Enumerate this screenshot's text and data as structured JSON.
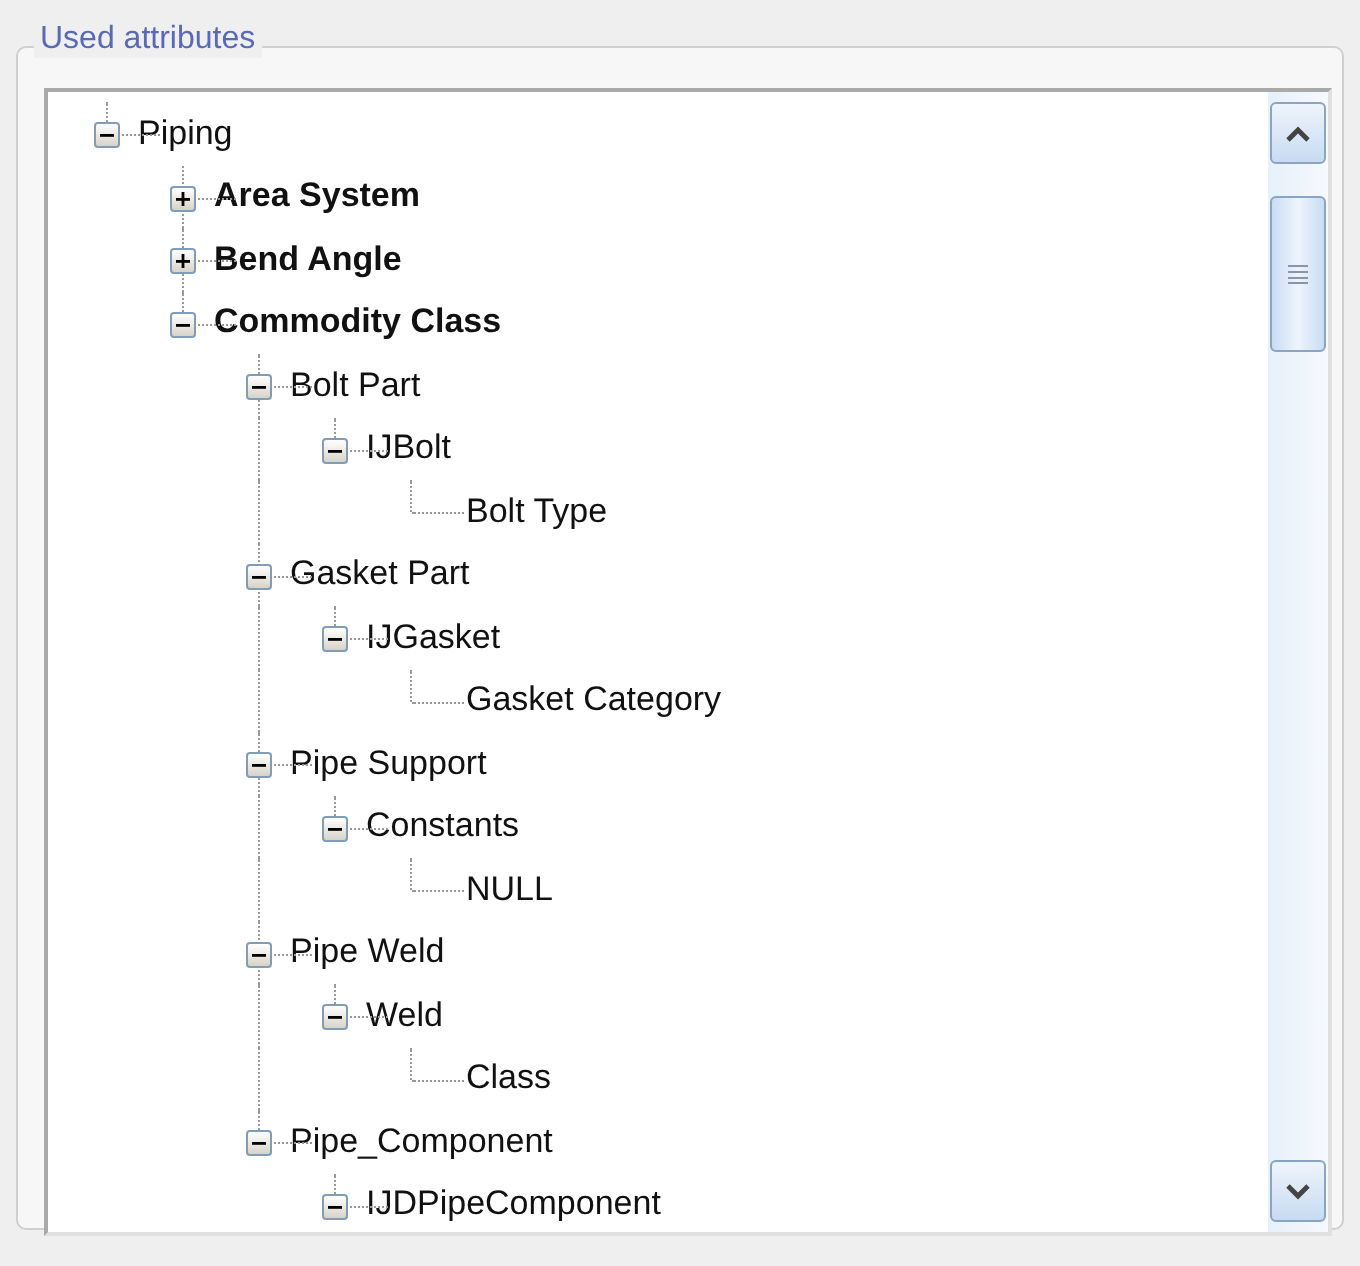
{
  "group_title": "Used attributes",
  "tree": [
    {
      "label": "Piping",
      "bold": false,
      "expanded": true,
      "children": [
        {
          "label": "Area System",
          "bold": true,
          "expanded": false
        },
        {
          "label": "Bend Angle",
          "bold": true,
          "expanded": false
        },
        {
          "label": "Commodity Class",
          "bold": true,
          "expanded": true,
          "children": [
            {
              "label": "Bolt Part",
              "bold": false,
              "expanded": true,
              "children": [
                {
                  "label": "IJBolt",
                  "bold": false,
                  "expanded": true,
                  "children": [
                    {
                      "label": "Bolt Type",
                      "bold": false
                    }
                  ]
                }
              ]
            },
            {
              "label": "Gasket Part",
              "bold": false,
              "expanded": true,
              "children": [
                {
                  "label": "IJGasket",
                  "bold": false,
                  "expanded": true,
                  "children": [
                    {
                      "label": "Gasket Category",
                      "bold": false
                    }
                  ]
                }
              ]
            },
            {
              "label": "Pipe Support",
              "bold": false,
              "expanded": true,
              "children": [
                {
                  "label": "Constants",
                  "bold": false,
                  "expanded": true,
                  "children": [
                    {
                      "label": "NULL",
                      "bold": false
                    }
                  ]
                }
              ]
            },
            {
              "label": "Pipe Weld",
              "bold": false,
              "expanded": true,
              "children": [
                {
                  "label": "Weld",
                  "bold": false,
                  "expanded": true,
                  "children": [
                    {
                      "label": "Class",
                      "bold": false
                    }
                  ]
                }
              ]
            },
            {
              "label": "Pipe_Component",
              "bold": false,
              "expanded": true,
              "children": [
                {
                  "label": "IJDPipeComponent",
                  "bold": false,
                  "expanded": true
                }
              ]
            }
          ]
        }
      ]
    }
  ]
}
